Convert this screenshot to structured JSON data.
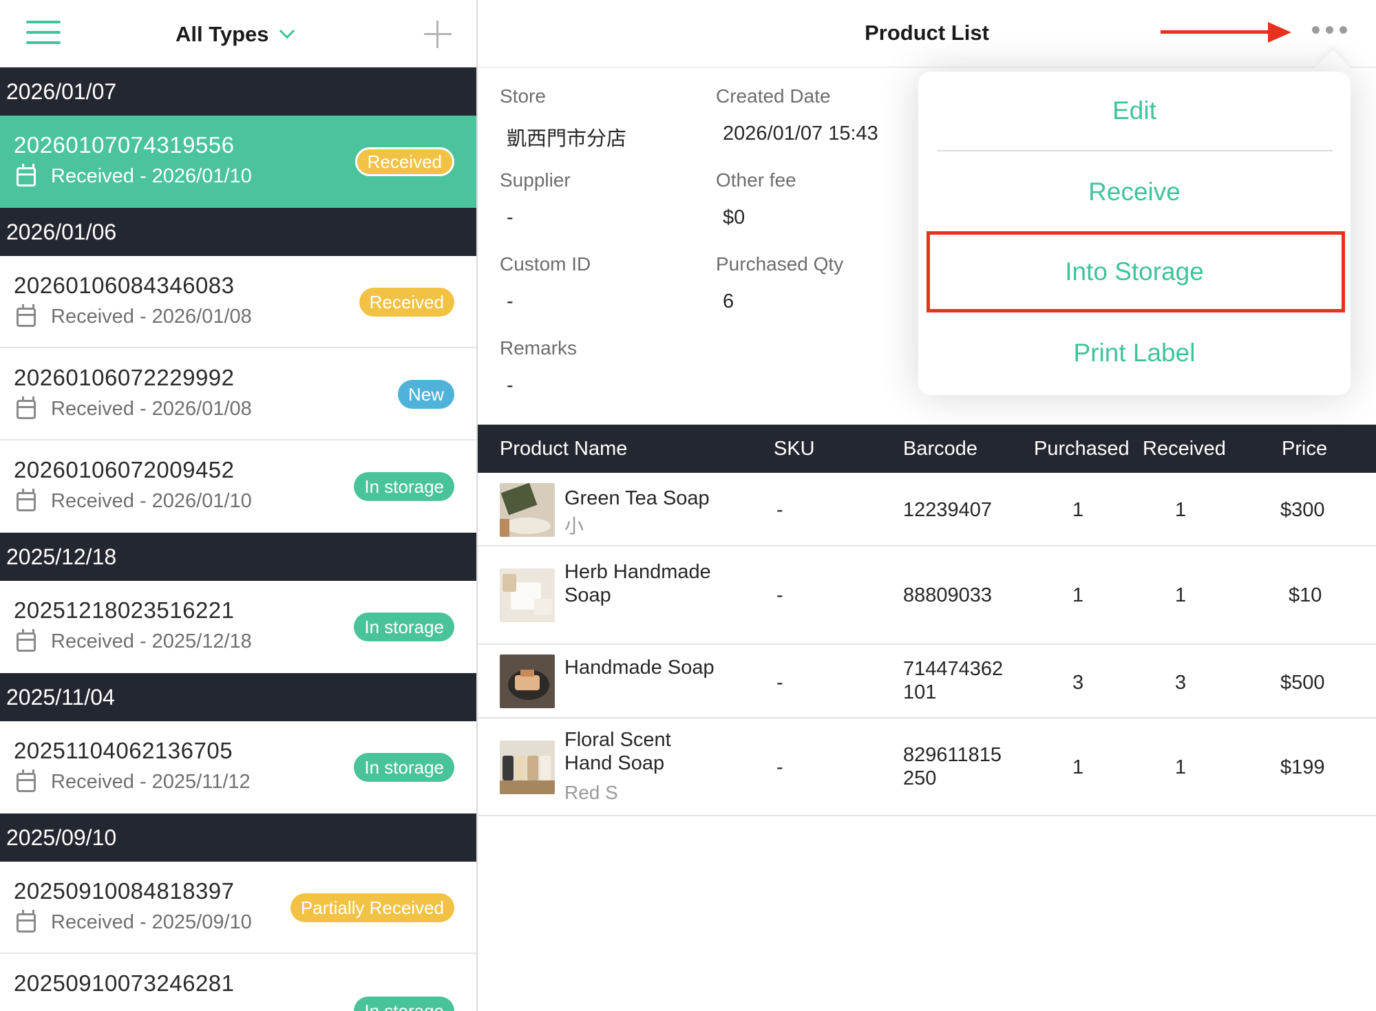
{
  "left": {
    "filter_label": "All Types",
    "groups": [
      {
        "date": "2026/01/07",
        "orders": [
          {
            "id": "20260107074319556",
            "sub": "Received - 2026/01/10",
            "badge": "Received"
          }
        ]
      },
      {
        "date": "2026/01/06",
        "orders": [
          {
            "id": "20260106084346083",
            "sub": "Received - 2026/01/08",
            "badge": "Received"
          },
          {
            "id": "20260106072229992",
            "sub": "Received - 2026/01/08",
            "badge": "New"
          },
          {
            "id": "20260106072009452",
            "sub": "Received - 2026/01/10",
            "badge": "In storage"
          }
        ]
      },
      {
        "date": "2025/12/18",
        "orders": [
          {
            "id": "20251218023516221",
            "sub": "Received - 2025/12/18",
            "badge": "In storage"
          }
        ]
      },
      {
        "date": "2025/11/04",
        "orders": [
          {
            "id": "20251104062136705",
            "sub": "Received - 2025/11/12",
            "badge": "In storage"
          }
        ]
      },
      {
        "date": "2025/09/10",
        "orders": [
          {
            "id": "20250910084818397",
            "sub": "Received - 2025/09/10",
            "badge": "Partially Received"
          },
          {
            "id": "20250910073246281",
            "sub": "",
            "badge": "In storage"
          }
        ]
      }
    ]
  },
  "right": {
    "title": "Product List",
    "info": {
      "store_label": "Store",
      "store_value": "凱西門市分店",
      "created_label": "Created Date",
      "created_value": "2026/01/07 15:43",
      "supplier_label": "Supplier",
      "supplier_value": "-",
      "fee_label": "Other fee",
      "fee_value": "$0",
      "custom_label": "Custom ID",
      "custom_value": "-",
      "qty_label": "Purchased Qty",
      "qty_value": "6",
      "remarks_label": "Remarks",
      "remarks_value": "-"
    },
    "menu": {
      "edit": "Edit",
      "receive": "Receive",
      "into_storage": "Into Storage",
      "print_label": "Print Label"
    },
    "table": {
      "headers": {
        "name": "Product Name",
        "sku": "SKU",
        "barcode": "Barcode",
        "purchased": "Purchased",
        "received": "Received",
        "price": "Price"
      },
      "rows": [
        {
          "name_1": "Green Tea Soap",
          "name_2": "",
          "variant": "小",
          "sku": "-",
          "barcode_1": "12239407",
          "barcode_2": "",
          "purchased": "1",
          "received": "1",
          "price": "$300"
        },
        {
          "name_1": "Herb Handmade",
          "name_2": "Soap",
          "variant": "",
          "sku": "-",
          "barcode_1": "88809033",
          "barcode_2": "",
          "purchased": "1",
          "received": "1",
          "price": "$10"
        },
        {
          "name_1": "Handmade Soap",
          "name_2": "",
          "variant": "",
          "sku": "-",
          "barcode_1": "714474362",
          "barcode_2": "101",
          "purchased": "3",
          "received": "3",
          "price": "$500"
        },
        {
          "name_1": "Floral Scent",
          "name_2": "Hand Soap",
          "variant": "Red S",
          "sku": "-",
          "barcode_1": "829611815",
          "barcode_2": "250",
          "purchased": "1",
          "received": "1",
          "price": "$199"
        }
      ]
    }
  },
  "colors": {
    "accent": "#3fc39b",
    "header_dark": "#232730",
    "badge_yellow": "#f2c244",
    "badge_blue": "#4fb3d9",
    "badge_green": "#49c39a",
    "annotation_red": "#e8311e"
  },
  "icons": [
    "hamburger-icon",
    "chevron-down-icon",
    "plus-icon",
    "calendar-icon",
    "more-icon",
    "arrow-annotation"
  ]
}
